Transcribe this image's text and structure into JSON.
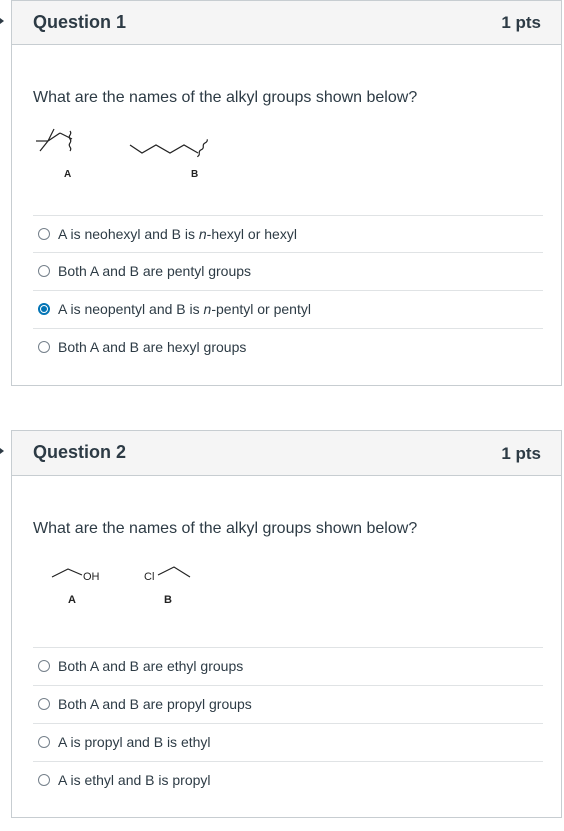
{
  "questions": [
    {
      "title": "Question 1",
      "points": "1 pts",
      "prompt": "What are the names of the alkyl groups shown below?",
      "figure": {
        "label_a": "A",
        "label_b": "B"
      },
      "answers": [
        {
          "pre": "A is neohexyl and B is ",
          "em": "n",
          "post": "-hexyl or hexyl",
          "selected": false
        },
        {
          "pre": "Both A and B are pentyl groups",
          "em": "",
          "post": "",
          "selected": false
        },
        {
          "pre": "A is neopentyl and B is ",
          "em": "n",
          "post": "-pentyl or pentyl",
          "selected": true
        },
        {
          "pre": "Both A and B are hexyl groups",
          "em": "",
          "post": "",
          "selected": false
        }
      ]
    },
    {
      "title": "Question 2",
      "points": "1 pts",
      "prompt": "What are the names of the alkyl groups shown below?",
      "figure": {
        "oh": "OH",
        "cl": "Cl",
        "label_a": "A",
        "label_b": "B"
      },
      "answers": [
        {
          "label": "Both A and B are ethyl groups",
          "selected": false
        },
        {
          "label": "Both A and B are propyl groups",
          "selected": false
        },
        {
          "label": "A is propyl and B is ethyl",
          "selected": false
        },
        {
          "label": "A is ethyl and B is propyl",
          "selected": false
        }
      ]
    }
  ],
  "colors": {
    "accent": "#0374b5",
    "header_bg": "#f5f5f5",
    "border": "#c7cdd1",
    "text": "#2d3b45"
  }
}
